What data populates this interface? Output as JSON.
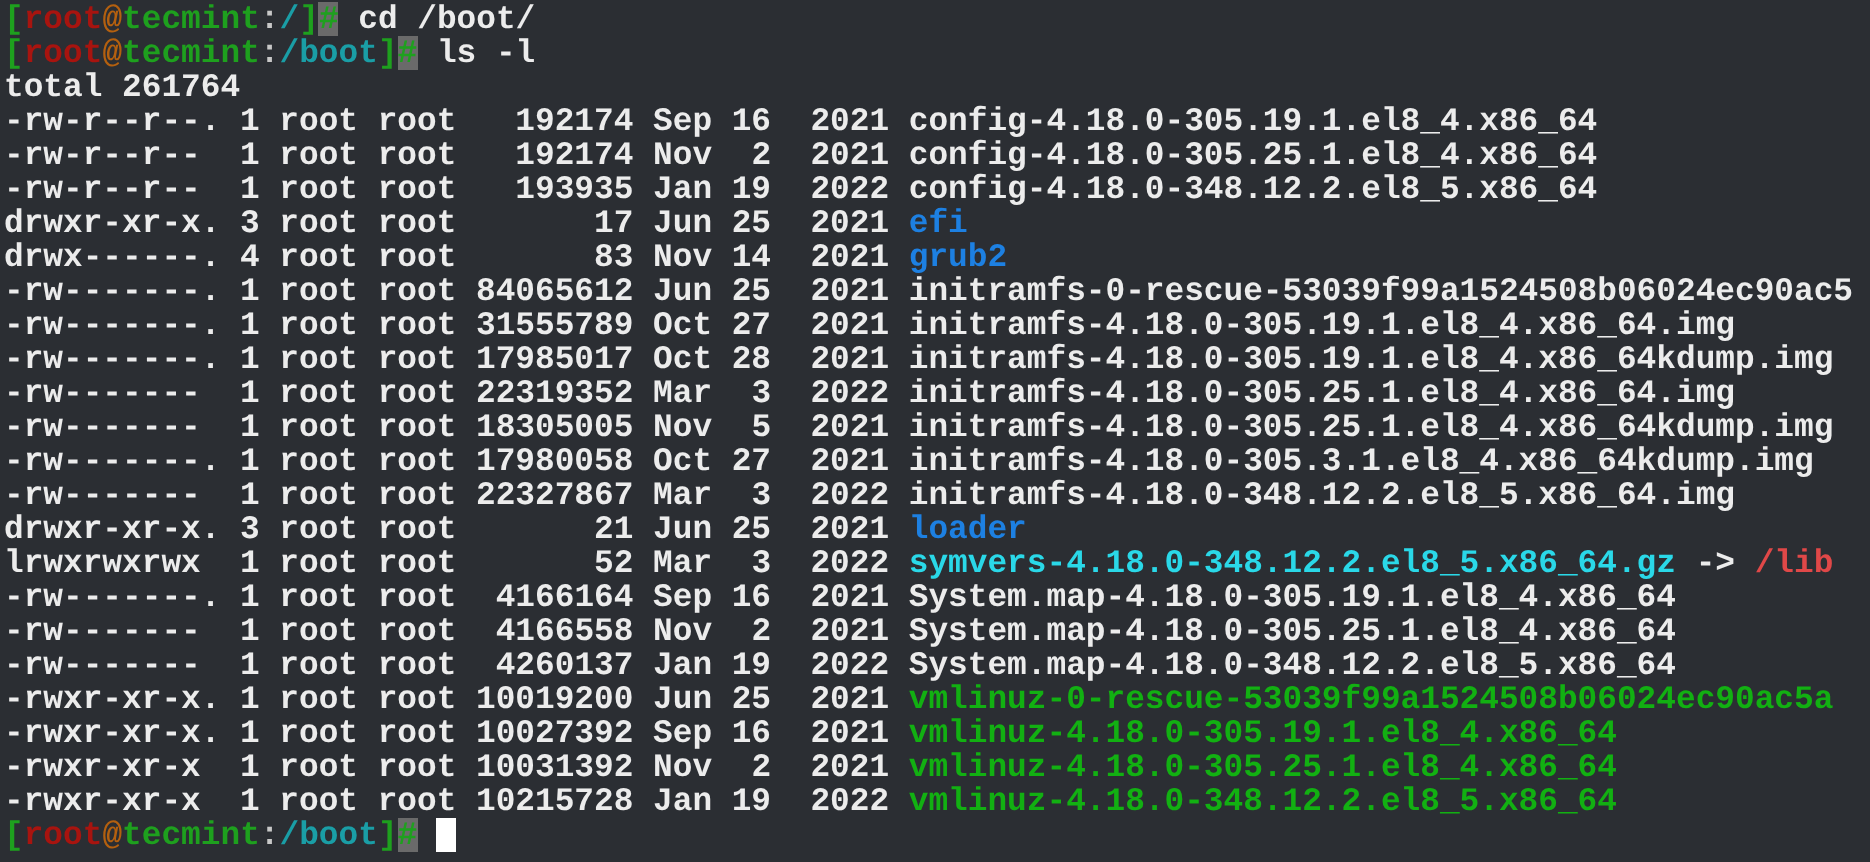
{
  "terminal": {
    "lines": [
      {
        "kind": "prompt",
        "prompt": [
          {
            "kind": "bracket",
            "text": "["
          },
          {
            "kind": "user",
            "text": "root"
          },
          {
            "kind": "at",
            "text": "@"
          },
          {
            "kind": "host",
            "text": "tecmint"
          },
          {
            "kind": "colon",
            "text": ":"
          },
          {
            "kind": "path",
            "text": "/"
          },
          {
            "kind": "bracket",
            "text": "]"
          },
          {
            "kind": "hash",
            "text": "#"
          }
        ],
        "command": "cd /boot/"
      },
      {
        "kind": "prompt",
        "prompt": [
          {
            "kind": "bracket",
            "text": "["
          },
          {
            "kind": "user",
            "text": "root"
          },
          {
            "kind": "at",
            "text": "@"
          },
          {
            "kind": "host",
            "text": "tecmint"
          },
          {
            "kind": "colon",
            "text": ":"
          },
          {
            "kind": "path",
            "text": "/boot"
          },
          {
            "kind": "bracket",
            "text": "]"
          },
          {
            "kind": "hash",
            "text": "#"
          }
        ],
        "command": "ls -l"
      },
      {
        "kind": "output",
        "text": "total 261764"
      },
      {
        "kind": "entry",
        "perms": "-rw-r--r--.",
        "links": "1",
        "owner": "root",
        "group": "root",
        "size": "192174",
        "month": "Sep",
        "day": "16",
        "year": "2021",
        "file": {
          "kind": "file",
          "text": "config-4.18.0-305.19.1.el8_4.x86_64"
        }
      },
      {
        "kind": "entry",
        "perms": "-rw-r--r--",
        "links": "1",
        "owner": "root",
        "group": "root",
        "size": "192174",
        "month": "Nov",
        "day": "2",
        "year": "2021",
        "file": {
          "kind": "file",
          "text": "config-4.18.0-305.25.1.el8_4.x86_64"
        }
      },
      {
        "kind": "entry",
        "perms": "-rw-r--r--",
        "links": "1",
        "owner": "root",
        "group": "root",
        "size": "193935",
        "month": "Jan",
        "day": "19",
        "year": "2022",
        "file": {
          "kind": "file",
          "text": "config-4.18.0-348.12.2.el8_5.x86_64"
        }
      },
      {
        "kind": "entry",
        "perms": "drwxr-xr-x.",
        "links": "3",
        "owner": "root",
        "group": "root",
        "size": "17",
        "month": "Jun",
        "day": "25",
        "year": "2021",
        "file": {
          "kind": "dir",
          "text": "efi"
        }
      },
      {
        "kind": "entry",
        "perms": "drwx------.",
        "links": "4",
        "owner": "root",
        "group": "root",
        "size": "83",
        "month": "Nov",
        "day": "14",
        "year": "2021",
        "file": {
          "kind": "dir",
          "text": "grub2"
        }
      },
      {
        "kind": "entry",
        "perms": "-rw-------.",
        "links": "1",
        "owner": "root",
        "group": "root",
        "size": "84065612",
        "month": "Jun",
        "day": "25",
        "year": "2021",
        "file": {
          "kind": "file",
          "text": "initramfs-0-rescue-53039f99a1524508b06024ec90ac5"
        }
      },
      {
        "kind": "entry",
        "perms": "-rw-------.",
        "links": "1",
        "owner": "root",
        "group": "root",
        "size": "31555789",
        "month": "Oct",
        "day": "27",
        "year": "2021",
        "file": {
          "kind": "file",
          "text": "initramfs-4.18.0-305.19.1.el8_4.x86_64.img"
        }
      },
      {
        "kind": "entry",
        "perms": "-rw-------.",
        "links": "1",
        "owner": "root",
        "group": "root",
        "size": "17985017",
        "month": "Oct",
        "day": "28",
        "year": "2021",
        "file": {
          "kind": "file",
          "text": "initramfs-4.18.0-305.19.1.el8_4.x86_64kdump.img"
        }
      },
      {
        "kind": "entry",
        "perms": "-rw-------",
        "links": "1",
        "owner": "root",
        "group": "root",
        "size": "22319352",
        "month": "Mar",
        "day": "3",
        "year": "2022",
        "file": {
          "kind": "file",
          "text": "initramfs-4.18.0-305.25.1.el8_4.x86_64.img"
        }
      },
      {
        "kind": "entry",
        "perms": "-rw-------",
        "links": "1",
        "owner": "root",
        "group": "root",
        "size": "18305005",
        "month": "Nov",
        "day": "5",
        "year": "2021",
        "file": {
          "kind": "file",
          "text": "initramfs-4.18.0-305.25.1.el8_4.x86_64kdump.img"
        }
      },
      {
        "kind": "entry",
        "perms": "-rw-------.",
        "links": "1",
        "owner": "root",
        "group": "root",
        "size": "17980058",
        "month": "Oct",
        "day": "27",
        "year": "2021",
        "file": {
          "kind": "file",
          "text": "initramfs-4.18.0-305.3.1.el8_4.x86_64kdump.img"
        }
      },
      {
        "kind": "entry",
        "perms": "-rw-------",
        "links": "1",
        "owner": "root",
        "group": "root",
        "size": "22327867",
        "month": "Mar",
        "day": "3",
        "year": "2022",
        "file": {
          "kind": "file",
          "text": "initramfs-4.18.0-348.12.2.el8_5.x86_64.img"
        }
      },
      {
        "kind": "entry",
        "perms": "drwxr-xr-x.",
        "links": "3",
        "owner": "root",
        "group": "root",
        "size": "21",
        "month": "Jun",
        "day": "25",
        "year": "2021",
        "file": {
          "kind": "dir",
          "text": "loader"
        }
      },
      {
        "kind": "entry",
        "perms": "lrwxrwxrwx",
        "links": "1",
        "owner": "root",
        "group": "root",
        "size": "52",
        "month": "Mar",
        "day": "3",
        "year": "2022",
        "file": {
          "kind": "link",
          "text": "symvers-4.18.0-348.12.2.el8_5.x86_64.gz"
        },
        "arrow": "->",
        "target": "/lib"
      },
      {
        "kind": "entry",
        "perms": "-rw-------.",
        "links": "1",
        "owner": "root",
        "group": "root",
        "size": "4166164",
        "month": "Sep",
        "day": "16",
        "year": "2021",
        "file": {
          "kind": "file",
          "text": "System.map-4.18.0-305.19.1.el8_4.x86_64"
        }
      },
      {
        "kind": "entry",
        "perms": "-rw-------",
        "links": "1",
        "owner": "root",
        "group": "root",
        "size": "4166558",
        "month": "Nov",
        "day": "2",
        "year": "2021",
        "file": {
          "kind": "file",
          "text": "System.map-4.18.0-305.25.1.el8_4.x86_64"
        }
      },
      {
        "kind": "entry",
        "perms": "-rw-------",
        "links": "1",
        "owner": "root",
        "group": "root",
        "size": "4260137",
        "month": "Jan",
        "day": "19",
        "year": "2022",
        "file": {
          "kind": "file",
          "text": "System.map-4.18.0-348.12.2.el8_5.x86_64"
        }
      },
      {
        "kind": "entry",
        "perms": "-rwxr-xr-x.",
        "links": "1",
        "owner": "root",
        "group": "root",
        "size": "10019200",
        "month": "Jun",
        "day": "25",
        "year": "2021",
        "file": {
          "kind": "exec",
          "text": "vmlinuz-0-rescue-53039f99a1524508b06024ec90ac5a"
        }
      },
      {
        "kind": "entry",
        "perms": "-rwxr-xr-x.",
        "links": "1",
        "owner": "root",
        "group": "root",
        "size": "10027392",
        "month": "Sep",
        "day": "16",
        "year": "2021",
        "file": {
          "kind": "exec",
          "text": "vmlinuz-4.18.0-305.19.1.el8_4.x86_64"
        }
      },
      {
        "kind": "entry",
        "perms": "-rwxr-xr-x",
        "links": "1",
        "owner": "root",
        "group": "root",
        "size": "10031392",
        "month": "Nov",
        "day": "2",
        "year": "2021",
        "file": {
          "kind": "exec",
          "text": "vmlinuz-4.18.0-305.25.1.el8_4.x86_64"
        }
      },
      {
        "kind": "entry",
        "perms": "-rwxr-xr-x",
        "links": "1",
        "owner": "root",
        "group": "root",
        "size": "10215728",
        "month": "Jan",
        "day": "19",
        "year": "2022",
        "file": {
          "kind": "exec",
          "text": "vmlinuz-4.18.0-348.12.2.el8_5.x86_64"
        }
      },
      {
        "kind": "prompt",
        "prompt": [
          {
            "kind": "bracket",
            "text": "["
          },
          {
            "kind": "user",
            "text": "root"
          },
          {
            "kind": "at",
            "text": "@"
          },
          {
            "kind": "host",
            "text": "tecmint"
          },
          {
            "kind": "colon",
            "text": ":"
          },
          {
            "kind": "path",
            "text": "/boot"
          },
          {
            "kind": "bracket",
            "text": "]"
          },
          {
            "kind": "hash",
            "text": "#"
          }
        ],
        "cursor": true
      }
    ]
  }
}
